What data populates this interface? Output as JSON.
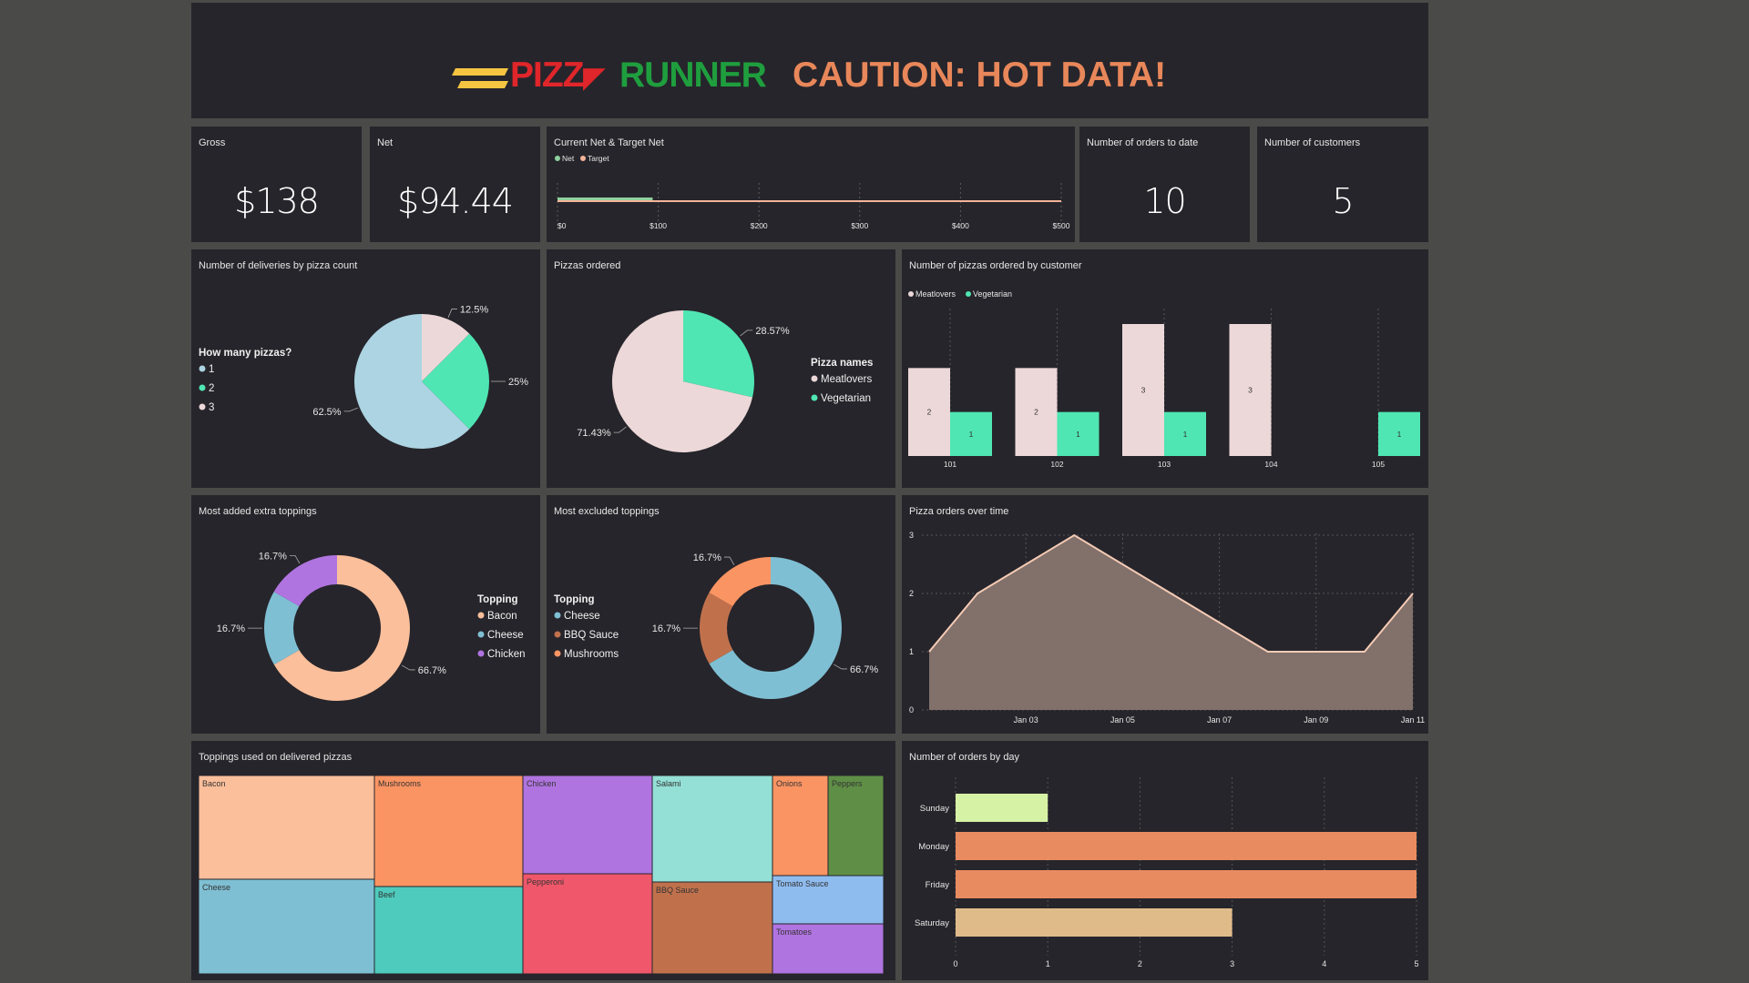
{
  "banner": {
    "logo_part1": "PIZZ",
    "logo_part2": "RUNNER",
    "caution": "CAUTION: HOT DATA!",
    "colors": {
      "pizz": "#e0262a",
      "runner": "#1f9e3e",
      "caution": "#e8875a",
      "stripes": "#f5c542"
    }
  },
  "kpis": {
    "gross": {
      "label": "Gross",
      "value": "$138"
    },
    "net": {
      "label": "Net",
      "value": "$94.44"
    },
    "orders": {
      "label": "Number of orders to date",
      "value": "10"
    },
    "customers": {
      "label": "Number of customers",
      "value": "5"
    }
  },
  "chart_data": [
    {
      "id": "net_target",
      "type": "bar",
      "title": "Current Net & Target Net",
      "legend": [
        "Net",
        "Target"
      ],
      "series": [
        {
          "name": "Net",
          "value": 94.44,
          "color": "#8fd19e"
        },
        {
          "name": "Target",
          "value": 500,
          "color": "#f4b49a"
        }
      ],
      "xticks": [
        "$0",
        "$100",
        "$200",
        "$300",
        "$400",
        "$500"
      ],
      "xlim": [
        0,
        500
      ]
    },
    {
      "id": "deliveries_by_count",
      "type": "pie",
      "title": "Number of deliveries by pizza count",
      "legend_title": "How many pizzas?",
      "slices": [
        {
          "label": "1",
          "value": 62.5,
          "text": "62.5%",
          "color": "#acd4e2"
        },
        {
          "label": "2",
          "value": 25,
          "text": "25%",
          "color": "#4fe6b3"
        },
        {
          "label": "3",
          "value": 12.5,
          "text": "12.5%",
          "color": "#ecd8d8"
        }
      ]
    },
    {
      "id": "pizzas_ordered",
      "type": "pie",
      "title": "Pizzas ordered",
      "legend_title": "Pizza names",
      "slices": [
        {
          "label": "Meatlovers",
          "value": 71.43,
          "text": "71.43%",
          "color": "#ecd8d8"
        },
        {
          "label": "Vegetarian",
          "value": 28.57,
          "text": "28.57%",
          "color": "#4fe6b3"
        }
      ]
    },
    {
      "id": "pizzas_by_customer",
      "type": "bar",
      "title": "Number of pizzas ordered by customer",
      "categories": [
        "101",
        "102",
        "103",
        "104",
        "105"
      ],
      "series": [
        {
          "name": "Meatlovers",
          "values": [
            2,
            2,
            3,
            3,
            0
          ],
          "color": "#ecd8d8"
        },
        {
          "name": "Vegetarian",
          "values": [
            1,
            1,
            1,
            0,
            1
          ],
          "color": "#4fe6b3"
        }
      ],
      "ylim": [
        0,
        3
      ]
    },
    {
      "id": "extra_toppings",
      "type": "pie",
      "title": "Most added extra toppings",
      "legend_title": "Topping",
      "slices": [
        {
          "label": "Bacon",
          "value": 66.7,
          "text": "66.7%",
          "color": "#fbbf9b"
        },
        {
          "label": "Cheese",
          "value": 16.7,
          "text": "16.7%",
          "color": "#7fbfd3"
        },
        {
          "label": "Chicken",
          "value": 16.7,
          "text": "16.7%",
          "color": "#b074e0"
        }
      ]
    },
    {
      "id": "excluded_toppings",
      "type": "pie",
      "title": "Most excluded toppings",
      "legend_title": "Topping",
      "slices": [
        {
          "label": "Cheese",
          "value": 66.7,
          "text": "66.7%",
          "color": "#7fbfd3"
        },
        {
          "label": "BBQ Sauce",
          "value": 16.7,
          "text": "16.7%",
          "color": "#c0714c"
        },
        {
          "label": "Mushrooms",
          "value": 16.7,
          "text": "16.7%",
          "color": "#fb9463"
        }
      ]
    },
    {
      "id": "orders_over_time",
      "type": "area",
      "title": "Pizza orders over time",
      "x": [
        "2020-01-01",
        "2020-01-02",
        "2020-01-04",
        "2020-01-08",
        "2020-01-09",
        "2020-01-10",
        "2020-01-11"
      ],
      "values": [
        1,
        2,
        3,
        1,
        1,
        1,
        2
      ],
      "xticks": [
        "Jan 03",
        "Jan 05",
        "Jan 07",
        "Jan 09",
        "Jan 11"
      ],
      "yticks": [
        "0",
        "1",
        "2",
        "3"
      ],
      "ylim": [
        0,
        3
      ],
      "colors": {
        "line": "#f5cbb5",
        "fill": "#82706a"
      }
    },
    {
      "id": "toppings_treemap",
      "type": "heatmap",
      "title": "Toppings used on delivered pizzas",
      "cells": [
        {
          "label": "Bacon",
          "color": "#fbbf9b"
        },
        {
          "label": "Cheese",
          "color": "#7fbfd3"
        },
        {
          "label": "Mushrooms",
          "color": "#fb9463"
        },
        {
          "label": "Beef",
          "color": "#4ecbbd"
        },
        {
          "label": "Chicken",
          "color": "#b074e0"
        },
        {
          "label": "Pepperoni",
          "color": "#f0576a"
        },
        {
          "label": "Salami",
          "color": "#94e0d6"
        },
        {
          "label": "BBQ Sauce",
          "color": "#c0714c"
        },
        {
          "label": "Onions",
          "color": "#fb9463"
        },
        {
          "label": "Peppers",
          "color": "#5f8f46"
        },
        {
          "label": "Tomato Sauce",
          "color": "#8fbcef"
        },
        {
          "label": "Tomatoes",
          "color": "#b074e0"
        }
      ]
    },
    {
      "id": "orders_by_day",
      "type": "bar",
      "title": "Number of orders by day",
      "categories": [
        "Sunday",
        "Monday",
        "Friday",
        "Saturday"
      ],
      "values": [
        1,
        5,
        5,
        3
      ],
      "colors": [
        "#d6f2a5",
        "#e98b60",
        "#e98b60",
        "#e0bb8a"
      ],
      "xticks": [
        "0",
        "1",
        "2",
        "3",
        "4",
        "5"
      ],
      "xlim": [
        0,
        5
      ]
    }
  ]
}
